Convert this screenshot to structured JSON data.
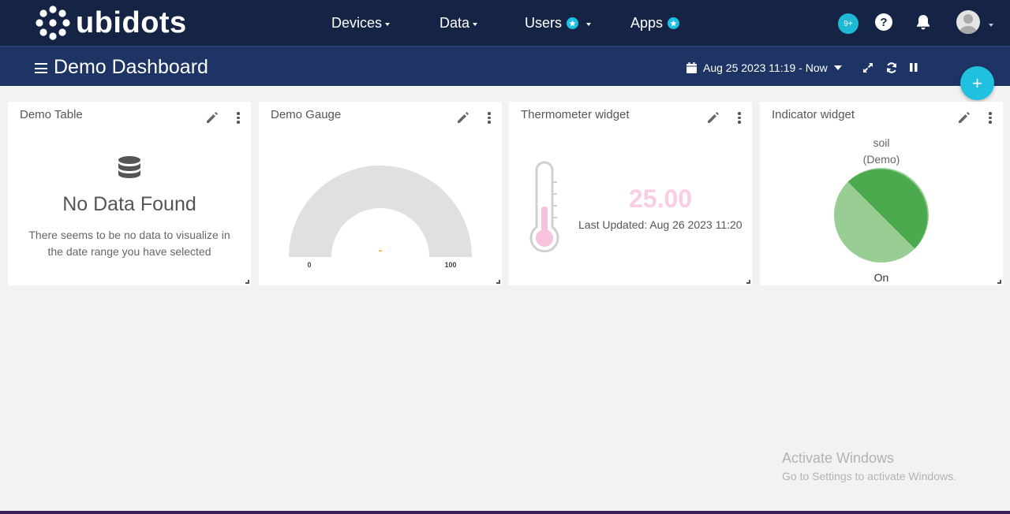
{
  "brand": {
    "name": "ubidots"
  },
  "nav": {
    "devices": "Devices",
    "data": "Data",
    "users": "Users",
    "apps": "Apps",
    "notifications_count": "9+",
    "help_glyph": "?"
  },
  "dashboard": {
    "title": "Demo Dashboard",
    "date_range": "Aug 25 2023 11:19 - Now",
    "add_glyph": "+"
  },
  "widgets": {
    "table": {
      "title": "Demo Table",
      "empty_title": "No Data Found",
      "empty_message": "There seems to be no data to visualize in the date range you have selected"
    },
    "gauge": {
      "title": "Demo Gauge",
      "min_label": "0",
      "max_label": "100",
      "value_label": "-"
    },
    "thermometer": {
      "title": "Thermometer widget",
      "value": "25.00",
      "last_updated": "Last Updated: Aug 26 2023 11:20"
    },
    "indicator": {
      "title": "Indicator widget",
      "variable": "soil",
      "subtitle": "(Demo)",
      "state": "On"
    }
  },
  "watermark": {
    "title": "Activate Windows",
    "subtitle": "Go to Settings to activate Windows."
  },
  "colors": {
    "nav_bg": "#152345",
    "subbar_bg": "#1e3465",
    "accent": "#1fc0e0",
    "therm_value": "#f9cde3",
    "gauge_track": "#e0e0e0",
    "gauge_value": "#f5a742",
    "indicator_dark": "#4caa4e",
    "indicator_light": "#98cd94"
  }
}
